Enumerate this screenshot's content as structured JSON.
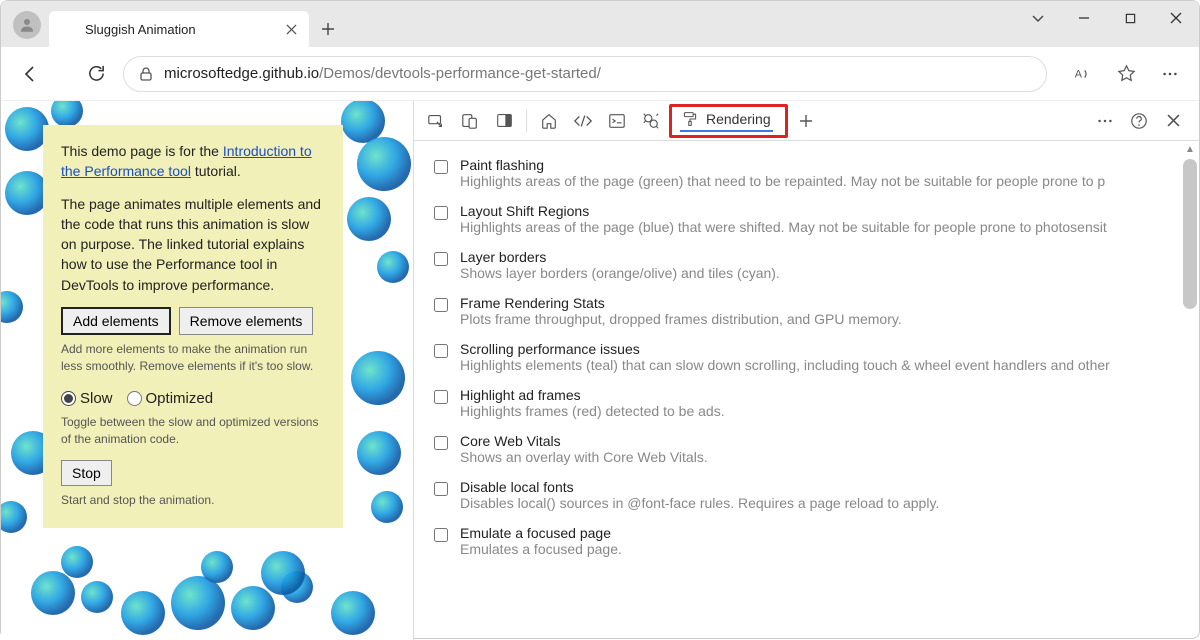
{
  "window": {
    "tab_title": "Sluggish Animation"
  },
  "address": {
    "host": "microsoftedge.github.io",
    "path": "/Demos/devtools-performance-get-started/"
  },
  "page": {
    "intro_pre": "This demo page is for the ",
    "intro_link": "Introduction to the Performance tool",
    "intro_post": " tutorial.",
    "desc": "The page animates multiple elements and the code that runs this animation is slow on purpose. The linked tutorial explains how to use the Performance tool in DevTools to improve performance.",
    "add_btn": "Add elements",
    "remove_btn": "Remove elements",
    "add_hint": "Add more elements to make the animation run less smoothly. Remove elements if it's too slow.",
    "radio_slow": "Slow",
    "radio_opt": "Optimized",
    "toggle_hint": "Toggle between the slow and optimized versions of the animation code.",
    "stop_btn": "Stop",
    "stop_hint": "Start and stop the animation."
  },
  "devtools": {
    "active_tab": "Rendering",
    "options": [
      {
        "title": "Paint flashing",
        "desc": "Highlights areas of the page (green) that need to be repainted. May not be suitable for people prone to p"
      },
      {
        "title": "Layout Shift Regions",
        "desc": "Highlights areas of the page (blue) that were shifted. May not be suitable for people prone to photosensit"
      },
      {
        "title": "Layer borders",
        "desc": "Shows layer borders (orange/olive) and tiles (cyan)."
      },
      {
        "title": "Frame Rendering Stats",
        "desc": "Plots frame throughput, dropped frames distribution, and GPU memory."
      },
      {
        "title": "Scrolling performance issues",
        "desc": "Highlights elements (teal) that can slow down scrolling, including touch & wheel event handlers and other"
      },
      {
        "title": "Highlight ad frames",
        "desc": "Highlights frames (red) detected to be ads."
      },
      {
        "title": "Core Web Vitals",
        "desc": "Shows an overlay with Core Web Vitals."
      },
      {
        "title": "Disable local fonts",
        "desc": "Disables local() sources in @font-face rules. Requires a page reload to apply."
      },
      {
        "title": "Emulate a focused page",
        "desc": "Emulates a focused page."
      }
    ]
  }
}
